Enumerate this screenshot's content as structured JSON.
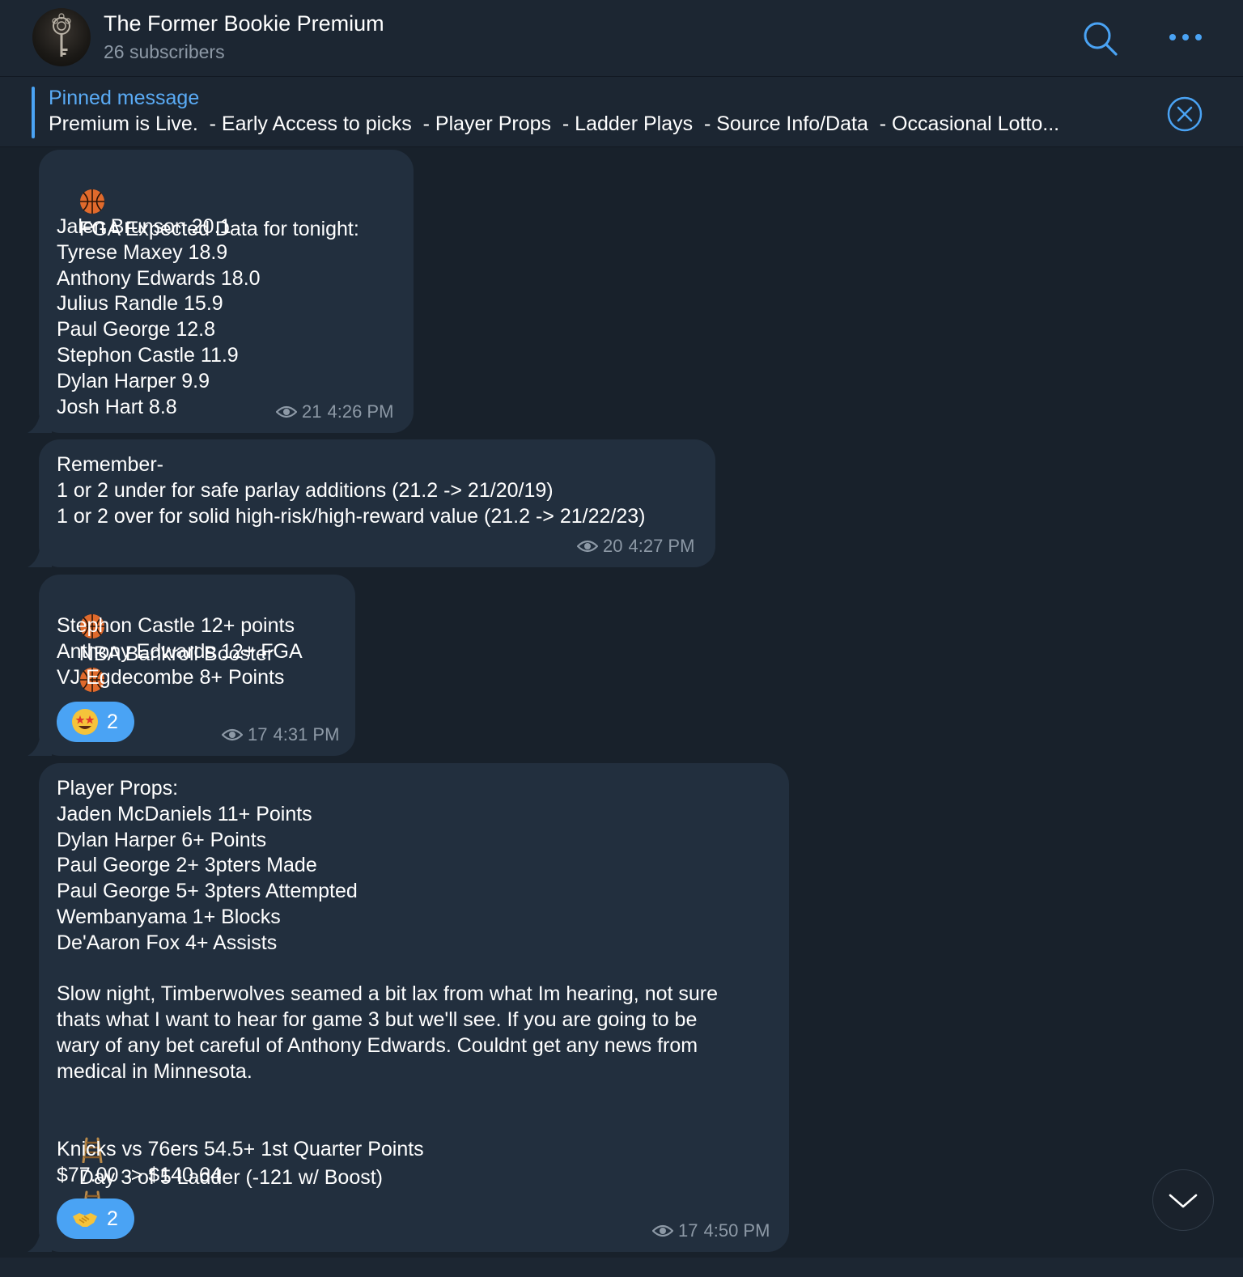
{
  "channel": {
    "title": "The Former Bookie Premium",
    "subscribers": "26 subscribers"
  },
  "header_icons": {
    "search": "search-icon",
    "more": "more-options-icon"
  },
  "pinned": {
    "title": "Pinned message",
    "text": "Premium is Live.  - Early Access to picks  - Player Props  - Ladder Plays  - Source Info/Data  - Occasional Lotto..."
  },
  "messages": [
    {
      "first_line": "FGA Expected Data for tonight:",
      "body": "Jalen Brunson 20.1\nTyrese Maxey 18.9\nAnthony Edwards 18.0\nJulius Randle 15.9\nPaul George 12.8\nStephon Castle 11.9\nDylan Harper 9.9\nJosh Hart 8.8",
      "views": "21",
      "time": "4:26 PM"
    },
    {
      "body": "Remember-\n1 or 2 under for safe parlay additions (21.2 -> 21/20/19)\n1 or 2 over for solid high-risk/high-reward value (21.2 -> 21/22/23)",
      "views": "20",
      "time": "4:27 PM"
    },
    {
      "first_line": "NBA Bankroll Booster",
      "body": "Stephon Castle 12+ points\nAnthony Edwards 12+ FGA\nVJ Egdecombe 8+ Points",
      "reaction": {
        "emoji": "star-struck-emoji",
        "count": "2"
      },
      "views": "17",
      "time": "4:31 PM"
    },
    {
      "body": "Player Props:\nJaden McDaniels 11+ Points\nDylan Harper 6+ Points\nPaul George 2+ 3pters Made\nPaul George 5+ 3pters Attempted\nWembanyama 1+ Blocks\nDe'Aaron Fox 4+ Assists\n\nSlow night, Timberwolves seamed a bit lax from what Im hearing, not sure\nthats what I want to hear for game 3 but we'll see. If you are going to be\nwary of any bet careful of Anthony Edwards. Couldnt get any news from\nmedical in Minnesota.",
      "ladder_line": "Day 3 of 5 Ladder (-121 w/ Boost)",
      "tail": "Knicks vs 76ers 54.5+ 1st Quarter Points\n$77.00 -> $140.64",
      "reaction": {
        "emoji": "handshake-emoji",
        "count": "2"
      },
      "views": "17",
      "time": "4:50 PM"
    }
  ],
  "colors": {
    "background": "#18212b",
    "header": "#1c2632",
    "bubble": "#222f3e",
    "accent": "#4aa3f4",
    "muted": "#8d99a6"
  }
}
